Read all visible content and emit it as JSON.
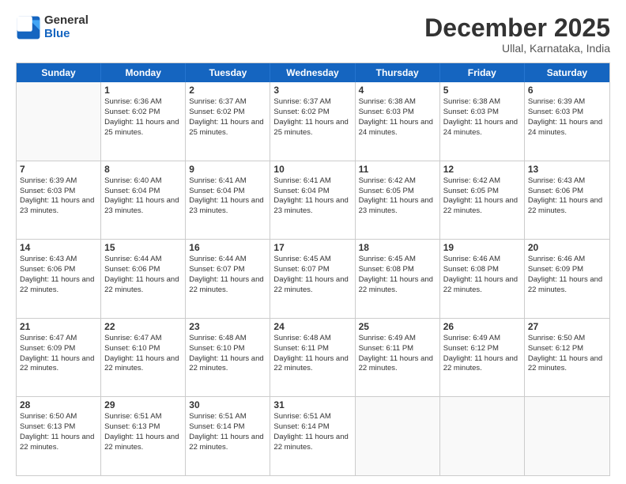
{
  "header": {
    "logo_general": "General",
    "logo_blue": "Blue",
    "month": "December 2025",
    "location": "Ullal, Karnataka, India"
  },
  "weekdays": [
    "Sunday",
    "Monday",
    "Tuesday",
    "Wednesday",
    "Thursday",
    "Friday",
    "Saturday"
  ],
  "weeks": [
    [
      {
        "day": "",
        "empty": true
      },
      {
        "day": "1",
        "sunrise": "6:36 AM",
        "sunset": "6:02 PM",
        "daylight": "11 hours and 25 minutes."
      },
      {
        "day": "2",
        "sunrise": "6:37 AM",
        "sunset": "6:02 PM",
        "daylight": "11 hours and 25 minutes."
      },
      {
        "day": "3",
        "sunrise": "6:37 AM",
        "sunset": "6:02 PM",
        "daylight": "11 hours and 25 minutes."
      },
      {
        "day": "4",
        "sunrise": "6:38 AM",
        "sunset": "6:03 PM",
        "daylight": "11 hours and 24 minutes."
      },
      {
        "day": "5",
        "sunrise": "6:38 AM",
        "sunset": "6:03 PM",
        "daylight": "11 hours and 24 minutes."
      },
      {
        "day": "6",
        "sunrise": "6:39 AM",
        "sunset": "6:03 PM",
        "daylight": "11 hours and 24 minutes."
      }
    ],
    [
      {
        "day": "7",
        "sunrise": "6:39 AM",
        "sunset": "6:03 PM",
        "daylight": "11 hours and 23 minutes."
      },
      {
        "day": "8",
        "sunrise": "6:40 AM",
        "sunset": "6:04 PM",
        "daylight": "11 hours and 23 minutes."
      },
      {
        "day": "9",
        "sunrise": "6:41 AM",
        "sunset": "6:04 PM",
        "daylight": "11 hours and 23 minutes."
      },
      {
        "day": "10",
        "sunrise": "6:41 AM",
        "sunset": "6:04 PM",
        "daylight": "11 hours and 23 minutes."
      },
      {
        "day": "11",
        "sunrise": "6:42 AM",
        "sunset": "6:05 PM",
        "daylight": "11 hours and 23 minutes."
      },
      {
        "day": "12",
        "sunrise": "6:42 AM",
        "sunset": "6:05 PM",
        "daylight": "11 hours and 22 minutes."
      },
      {
        "day": "13",
        "sunrise": "6:43 AM",
        "sunset": "6:06 PM",
        "daylight": "11 hours and 22 minutes."
      }
    ],
    [
      {
        "day": "14",
        "sunrise": "6:43 AM",
        "sunset": "6:06 PM",
        "daylight": "11 hours and 22 minutes."
      },
      {
        "day": "15",
        "sunrise": "6:44 AM",
        "sunset": "6:06 PM",
        "daylight": "11 hours and 22 minutes."
      },
      {
        "day": "16",
        "sunrise": "6:44 AM",
        "sunset": "6:07 PM",
        "daylight": "11 hours and 22 minutes."
      },
      {
        "day": "17",
        "sunrise": "6:45 AM",
        "sunset": "6:07 PM",
        "daylight": "11 hours and 22 minutes."
      },
      {
        "day": "18",
        "sunrise": "6:45 AM",
        "sunset": "6:08 PM",
        "daylight": "11 hours and 22 minutes."
      },
      {
        "day": "19",
        "sunrise": "6:46 AM",
        "sunset": "6:08 PM",
        "daylight": "11 hours and 22 minutes."
      },
      {
        "day": "20",
        "sunrise": "6:46 AM",
        "sunset": "6:09 PM",
        "daylight": "11 hours and 22 minutes."
      }
    ],
    [
      {
        "day": "21",
        "sunrise": "6:47 AM",
        "sunset": "6:09 PM",
        "daylight": "11 hours and 22 minutes."
      },
      {
        "day": "22",
        "sunrise": "6:47 AM",
        "sunset": "6:10 PM",
        "daylight": "11 hours and 22 minutes."
      },
      {
        "day": "23",
        "sunrise": "6:48 AM",
        "sunset": "6:10 PM",
        "daylight": "11 hours and 22 minutes."
      },
      {
        "day": "24",
        "sunrise": "6:48 AM",
        "sunset": "6:11 PM",
        "daylight": "11 hours and 22 minutes."
      },
      {
        "day": "25",
        "sunrise": "6:49 AM",
        "sunset": "6:11 PM",
        "daylight": "11 hours and 22 minutes."
      },
      {
        "day": "26",
        "sunrise": "6:49 AM",
        "sunset": "6:12 PM",
        "daylight": "11 hours and 22 minutes."
      },
      {
        "day": "27",
        "sunrise": "6:50 AM",
        "sunset": "6:12 PM",
        "daylight": "11 hours and 22 minutes."
      }
    ],
    [
      {
        "day": "28",
        "sunrise": "6:50 AM",
        "sunset": "6:13 PM",
        "daylight": "11 hours and 22 minutes."
      },
      {
        "day": "29",
        "sunrise": "6:51 AM",
        "sunset": "6:13 PM",
        "daylight": "11 hours and 22 minutes."
      },
      {
        "day": "30",
        "sunrise": "6:51 AM",
        "sunset": "6:14 PM",
        "daylight": "11 hours and 22 minutes."
      },
      {
        "day": "31",
        "sunrise": "6:51 AM",
        "sunset": "6:14 PM",
        "daylight": "11 hours and 22 minutes."
      },
      {
        "day": "",
        "empty": true
      },
      {
        "day": "",
        "empty": true
      },
      {
        "day": "",
        "empty": true
      }
    ]
  ]
}
